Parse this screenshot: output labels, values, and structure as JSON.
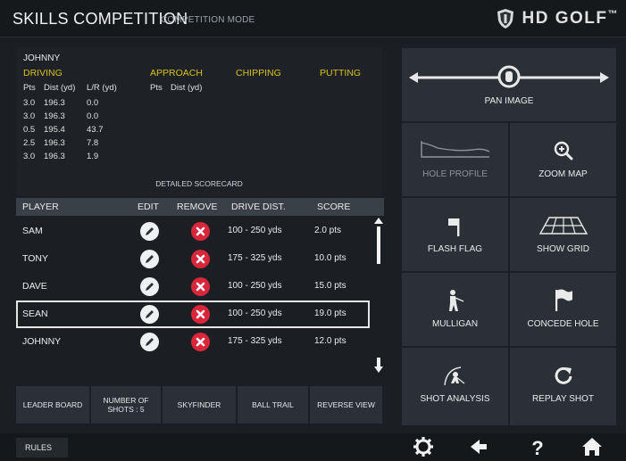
{
  "header": {
    "title": "SKILLS COMPETITION",
    "mode": "COMPETITION MODE",
    "logo_text": "HD GOLF",
    "logo_tm": "™"
  },
  "scorecard": {
    "player": "JOHNNY",
    "categories": [
      "DRIVING",
      "APPROACH",
      "CHIPPING",
      "PUTTING"
    ],
    "driving_cols": [
      "Pts",
      "Dist (yd)",
      "L/R (yd)"
    ],
    "approach_cols": [
      "Pts",
      "Dist (yd)"
    ],
    "driving_rows": [
      {
        "pts": "3.0",
        "dist": "196.3",
        "lr": "0.0"
      },
      {
        "pts": "3.0",
        "dist": "196.3",
        "lr": "0.0"
      },
      {
        "pts": "0.5",
        "dist": "195.4",
        "lr": "43.7"
      },
      {
        "pts": "2.5",
        "dist": "196.3",
        "lr": "7.8"
      },
      {
        "pts": "3.0",
        "dist": "196.3",
        "lr": "1.9"
      }
    ],
    "detailed_label": "DETAILED SCORECARD"
  },
  "players_table": {
    "headers": {
      "player": "PLAYER",
      "edit": "EDIT",
      "remove": "REMOVE",
      "drive": "DRIVE DIST.",
      "score": "SCORE"
    },
    "rows": [
      {
        "name": "SAM",
        "drive": "100 - 250 yds",
        "score": "2.0 pts"
      },
      {
        "name": "TONY",
        "drive": "175 - 325 yds",
        "score": "10.0 pts"
      },
      {
        "name": "DAVE",
        "drive": "100 - 250 yds",
        "score": "15.0 pts"
      },
      {
        "name": "SEAN",
        "drive": "100 - 250 yds",
        "score": "19.0 pts"
      },
      {
        "name": "JOHNNY",
        "drive": "175 - 325 yds",
        "score": "12.0 pts"
      }
    ]
  },
  "bottom_buttons": {
    "leader_board": "LEADER BOARD",
    "number_of_shots_line1": "NUMBER OF",
    "number_of_shots_line2": "SHOTS : 5",
    "skyfinder": "SKYFINDER",
    "ball_trail": "BALL TRAIL",
    "reverse_view": "REVERSE VIEW",
    "rules": "RULES"
  },
  "tools": {
    "pan_image": "PAN IMAGE",
    "hole_profile": "HOLE PROFILE",
    "zoom_map": "ZOOM MAP",
    "flash_flag": "FLASH FLAG",
    "show_grid": "SHOW GRID",
    "mulligan": "MULLIGAN",
    "concede_hole": "CONCEDE HOLE",
    "shot_analysis": "SHOT ANALYSIS",
    "replay_shot": "REPLAY SHOT"
  },
  "footer_icons": [
    "gear-icon",
    "back-arrow-icon",
    "help-icon",
    "home-icon"
  ],
  "colors": {
    "accent_yellow": "#d6c21f",
    "remove_red": "#d8263a",
    "tile_bg": "#2a3036"
  }
}
